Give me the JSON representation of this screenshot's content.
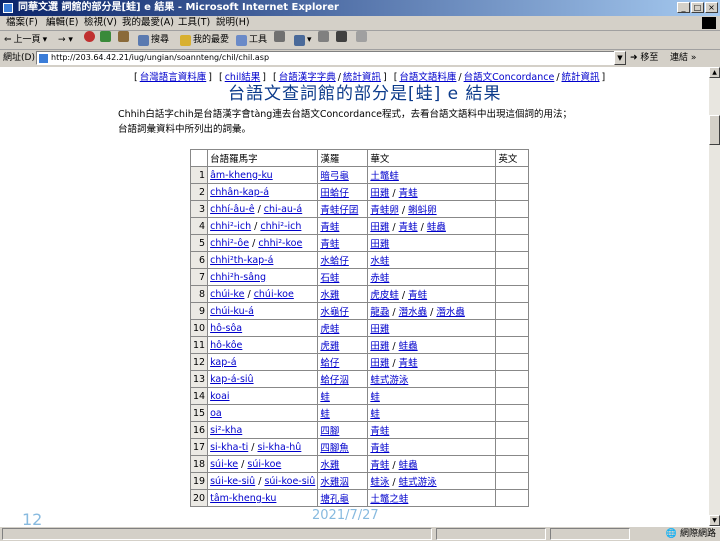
{
  "window": {
    "title": "同華文選 詞館的部分是[蛙] e 結果 - Microsoft Internet Explorer"
  },
  "menu": [
    "檔案(F)",
    "編輯(E)",
    "檢視(V)",
    "我的最愛(A)",
    "工具(T)",
    "說明(H)"
  ],
  "toolbar": {
    "back": "上一頁",
    "search": "搜尋",
    "favorites": "我的最愛",
    "tools": "工具"
  },
  "address": {
    "label": "網址(D)",
    "url": "http://203.64.42.21/iug/ungian/soannteng/chil/chil.asp",
    "go": "移至",
    "links": "連結"
  },
  "nav": {
    "items": [
      "台灣語言資料庫",
      "chil結果",
      "台語漢字字典",
      "統計資訊",
      "台語文語料庫",
      "台語文Concordance",
      "統計資訊"
    ]
  },
  "page": {
    "title": "台語文查詞館的部分是[蛙] e 結果",
    "description": "Chhih白話字chih是台語漢字會tàng連去台語文Concordance程式，去看台語文語料中出現這個詞的用法；台語詞彙資料中所列出的詞彙。"
  },
  "table": {
    "headers": [
      "",
      "台語羅馬字",
      "漢羅",
      "華文",
      "英文"
    ],
    "rows": [
      {
        "n": "1",
        "roman": [
          "âm-kheng-ku"
        ],
        "hanlo": "暗弓龜",
        "hua": [
          "土鼈蛙"
        ]
      },
      {
        "n": "2",
        "roman": [
          "chhân-kap-á"
        ],
        "hanlo": "田蛤仔",
        "hua": [
          "田雞",
          "青蛙"
        ]
      },
      {
        "n": "3",
        "roman": [
          "chhí-âu-ê",
          "chi-au-á"
        ],
        "hanlo": "青蛙仔囝",
        "hua": [
          "青蛙卵",
          "蝌蚪卵"
        ]
      },
      {
        "n": "4",
        "roman": [
          "chhi²-ich",
          "chhi²-ich"
        ],
        "hanlo": "青蛙",
        "hua": [
          "田雞",
          "青蛙",
          "蛙蟲"
        ]
      },
      {
        "n": "5",
        "roman": [
          "chhi²-ôe",
          "chhi²-koe"
        ],
        "hanlo": "青蛙",
        "hua": [
          "田雞"
        ]
      },
      {
        "n": "6",
        "roman": [
          "chhi²th-kap-á"
        ],
        "hanlo": "水蛤仔",
        "hua": [
          "水蛙"
        ]
      },
      {
        "n": "7",
        "roman": [
          "chhi²h-sâng"
        ],
        "hanlo": "石蛙",
        "hua": [
          "赤蛙"
        ]
      },
      {
        "n": "8",
        "roman": [
          "chúi-ke",
          "chúi-koe"
        ],
        "hanlo": "水雞",
        "hua": [
          "虎皮蛙",
          "青蛙"
        ]
      },
      {
        "n": "9",
        "roman": [
          "chúi-ku-á"
        ],
        "hanlo": "水龜仔",
        "hua": [
          "龍蝨",
          "潛水蟲",
          "潛水蟲"
        ]
      },
      {
        "n": "10",
        "roman": [
          "hô-sôa"
        ],
        "hanlo": "虎蛙",
        "hua": [
          "田雞"
        ]
      },
      {
        "n": "11",
        "roman": [
          "hô-kôe"
        ],
        "hanlo": "虎雞",
        "hua": [
          "田雞",
          "蛙蟲"
        ]
      },
      {
        "n": "12",
        "roman": [
          "kap-á"
        ],
        "hanlo": "蛤仔",
        "hua": [
          "田雞",
          "青蛙"
        ]
      },
      {
        "n": "13",
        "roman": [
          "kap-á-siû"
        ],
        "hanlo": "蛤仔泅",
        "hua": [
          "蛙式游泳"
        ]
      },
      {
        "n": "14",
        "roman": [
          "koai"
        ],
        "hanlo": "蛙",
        "hua": [
          "蛙"
        ]
      },
      {
        "n": "15",
        "roman": [
          "oa"
        ],
        "hanlo": "蛙",
        "hua": [
          "蛙"
        ]
      },
      {
        "n": "16",
        "roman": [
          "si²-kha"
        ],
        "hanlo": "四腳",
        "hua": [
          "青蛙"
        ]
      },
      {
        "n": "17",
        "roman": [
          "si-kha-ti",
          "si-kha-hû"
        ],
        "hanlo": "四腳魚",
        "hua": [
          "青蛙"
        ]
      },
      {
        "n": "18",
        "roman": [
          "súi-ke",
          "súi-koe"
        ],
        "hanlo": "水雞",
        "hua": [
          "青蛙",
          "蛙蟲"
        ]
      },
      {
        "n": "19",
        "roman": [
          "súi-ke-siû",
          "súi-koe-siû"
        ],
        "hanlo": "水雞泅",
        "hua": [
          "蛙泳",
          "蛙式游泳"
        ]
      },
      {
        "n": "20",
        "roman": [
          "tâm-kheng-ku"
        ],
        "hanlo": "塘孔龜",
        "hua": [
          "土鼈之蛙"
        ]
      }
    ]
  },
  "status": {
    "zone": "網際網路"
  },
  "overlay": {
    "slide_number": "12",
    "date": "2021/7/27"
  }
}
